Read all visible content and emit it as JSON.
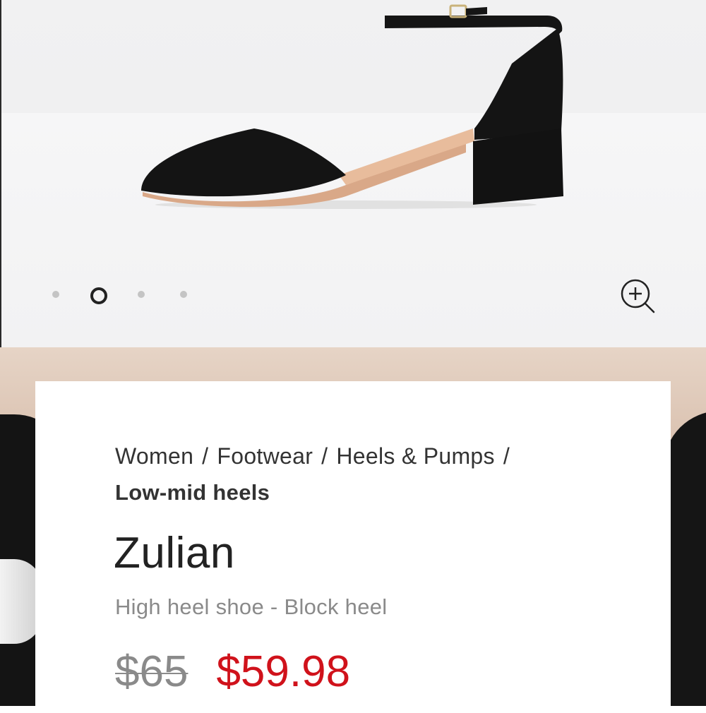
{
  "carousel": {
    "slide_count": 4,
    "active_index": 1,
    "zoom_icon": "zoom-in-icon"
  },
  "breadcrumb": {
    "items": [
      "Women",
      "Footwear",
      "Heels & Pumps"
    ],
    "separator": "/",
    "current": "Low-mid heels"
  },
  "product": {
    "name": "Zulian",
    "description": "High heel shoe - Block heel",
    "price_original": "$65",
    "price_sale": "$59.98"
  },
  "colors": {
    "sale_price": "#d0121b",
    "muted_text": "#8a8a8a",
    "primary_text": "#222222"
  }
}
